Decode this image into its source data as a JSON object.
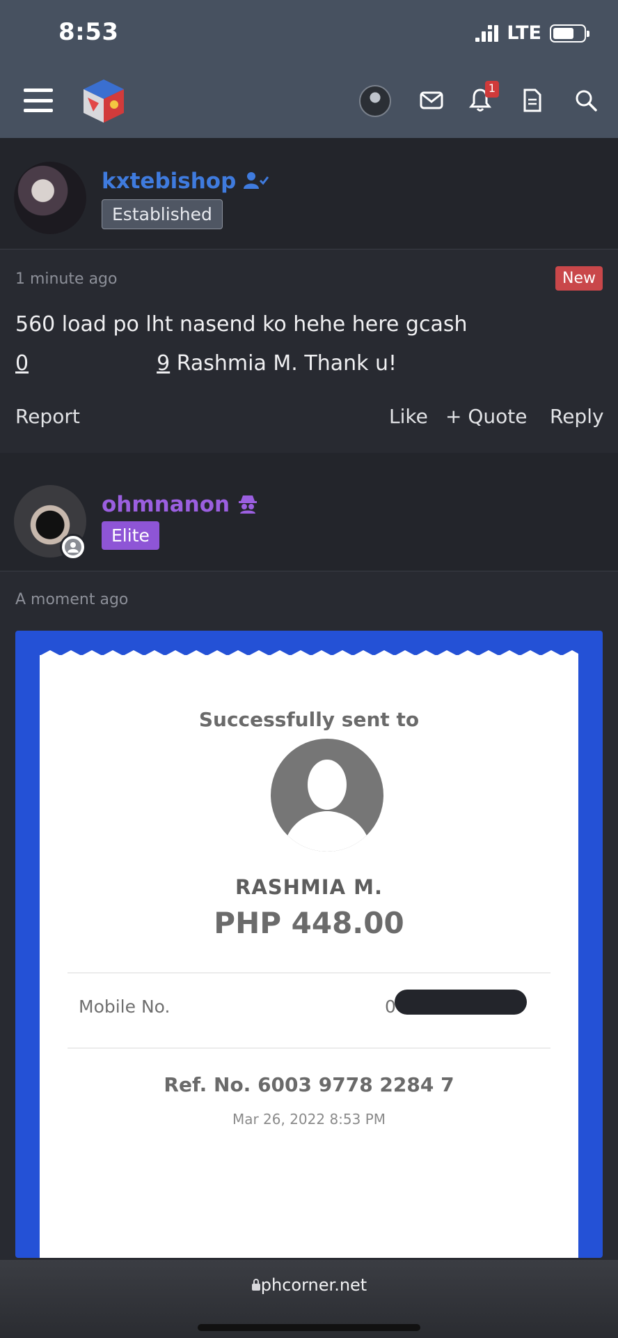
{
  "status_bar": {
    "time": "8:53",
    "network": "LTE"
  },
  "header": {
    "notifications_count": "1",
    "icons": [
      "menu-icon",
      "site-logo",
      "avatar",
      "mail-icon",
      "bell-icon",
      "document-icon",
      "search-icon"
    ]
  },
  "posts": [
    {
      "username": "kxtebishop",
      "rank": "Established",
      "time": "1 minute ago",
      "new_label": "New",
      "text_line1": "560 load po lht nasend ko hehe here gcash",
      "text_line2_start": "0",
      "text_line2_end": "9",
      "text_line2_rest": " Rashmia M. Thank u!",
      "actions": {
        "report": "Report",
        "like": "Like",
        "quote": "Quote",
        "reply": "Reply"
      }
    },
    {
      "username": "ohmnanon",
      "rank": "Elite",
      "time": "A moment ago",
      "receipt": {
        "title": "Successfully sent to",
        "name": "RASHMIA M.",
        "amount": "PHP 448.00",
        "mobile_label": "Mobile No.",
        "mobile_prefix": "0",
        "ref": "Ref. No. 6003 9778 2284 7",
        "date": "Mar 26, 2022 8:53 PM"
      }
    }
  ],
  "browser": {
    "url": "phcorner.net"
  },
  "colors": {
    "header_bg": "#475160",
    "page_bg": "#23252b",
    "user1_color": "#3f7bde",
    "user2_color": "#9b5fe0",
    "elite_badge": "#8e55d6",
    "new_badge": "#c9474a",
    "receipt_border": "#2451d6"
  }
}
